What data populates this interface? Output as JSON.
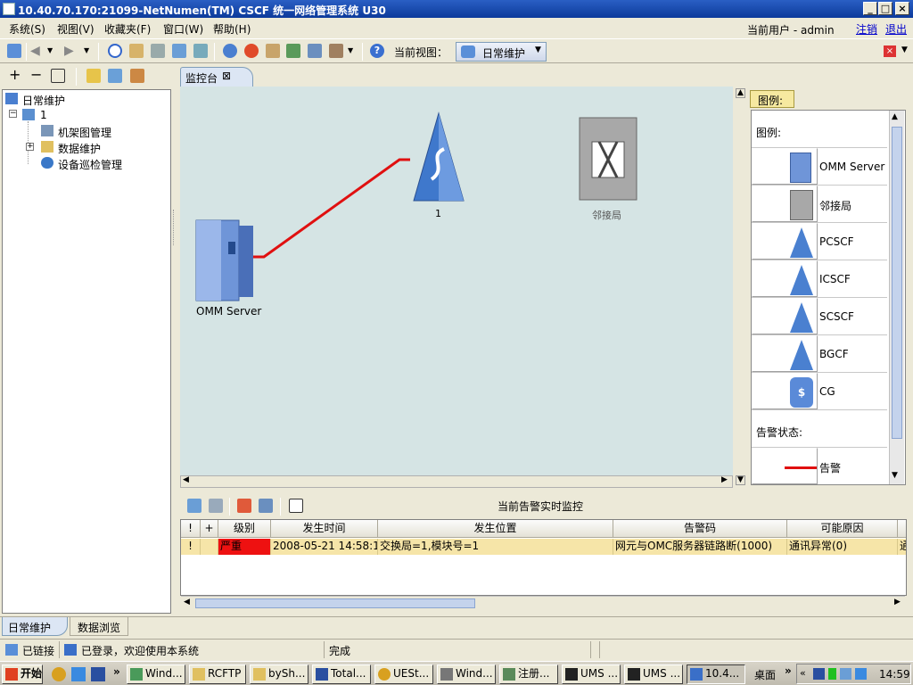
{
  "window": {
    "title": "10.40.70.170:21099-NetNumen(TM) CSCF 统一网络管理系统 U30"
  },
  "menu": {
    "items": [
      "系统(S)",
      "视图(V)",
      "收藏夹(F)",
      "窗口(W)",
      "帮助(H)"
    ],
    "current_user": "当前用户 - admin",
    "logout_link": "注销",
    "exit_link": "退出"
  },
  "toolbar": {
    "current_view_label": "当前视图：",
    "current_view_value": "日常维护"
  },
  "tree": {
    "root": "日常维护",
    "node": "1",
    "children": [
      "机架图管理",
      "数据维护",
      "设备巡检管理"
    ]
  },
  "main_tab": {
    "label": "监控台"
  },
  "topology": {
    "nodes": [
      "OMM Server",
      "1",
      "邻接局"
    ],
    "link_color": "#e01010"
  },
  "legend": {
    "tab_label": "图例:",
    "header": "图例:",
    "items": [
      "OMM Server",
      "邻接局",
      "PCSCF",
      "ICSCF",
      "SCSCF",
      "BGCF",
      "CG"
    ],
    "alarm_state_label": "告警状态:",
    "alarm_item": "告警"
  },
  "alarm_panel": {
    "title": "当前告警实时监控",
    "columns": [
      "!",
      "+",
      "级别",
      "发生时间",
      "发生位置",
      "告警码",
      "可能原因"
    ],
    "rows": [
      {
        "flag": "!",
        "plus": "",
        "level": "严重",
        "time": "2008-05-21 14:58:11",
        "location": "交换局=1,模块号=1",
        "code": "网元与OMC服务器链路断(1000)",
        "cause": "通讯异常(0)",
        "extra": "通"
      }
    ],
    "severity_color": "#ee1111"
  },
  "bottom_tabs": [
    "日常维护",
    "数据浏览"
  ],
  "status": {
    "connection": "已链接",
    "login": "已登录，欢迎使用本系统",
    "state": "完成"
  },
  "taskbar": {
    "start": "开始",
    "tasks": [
      "Wind...",
      "RCFTP",
      "bySh...",
      "Total...",
      "UESt...",
      "Wind...",
      "注册...",
      "UMS ...",
      "UMS ...",
      "10.4..."
    ],
    "desktop": "桌面",
    "clock": "14:59"
  }
}
